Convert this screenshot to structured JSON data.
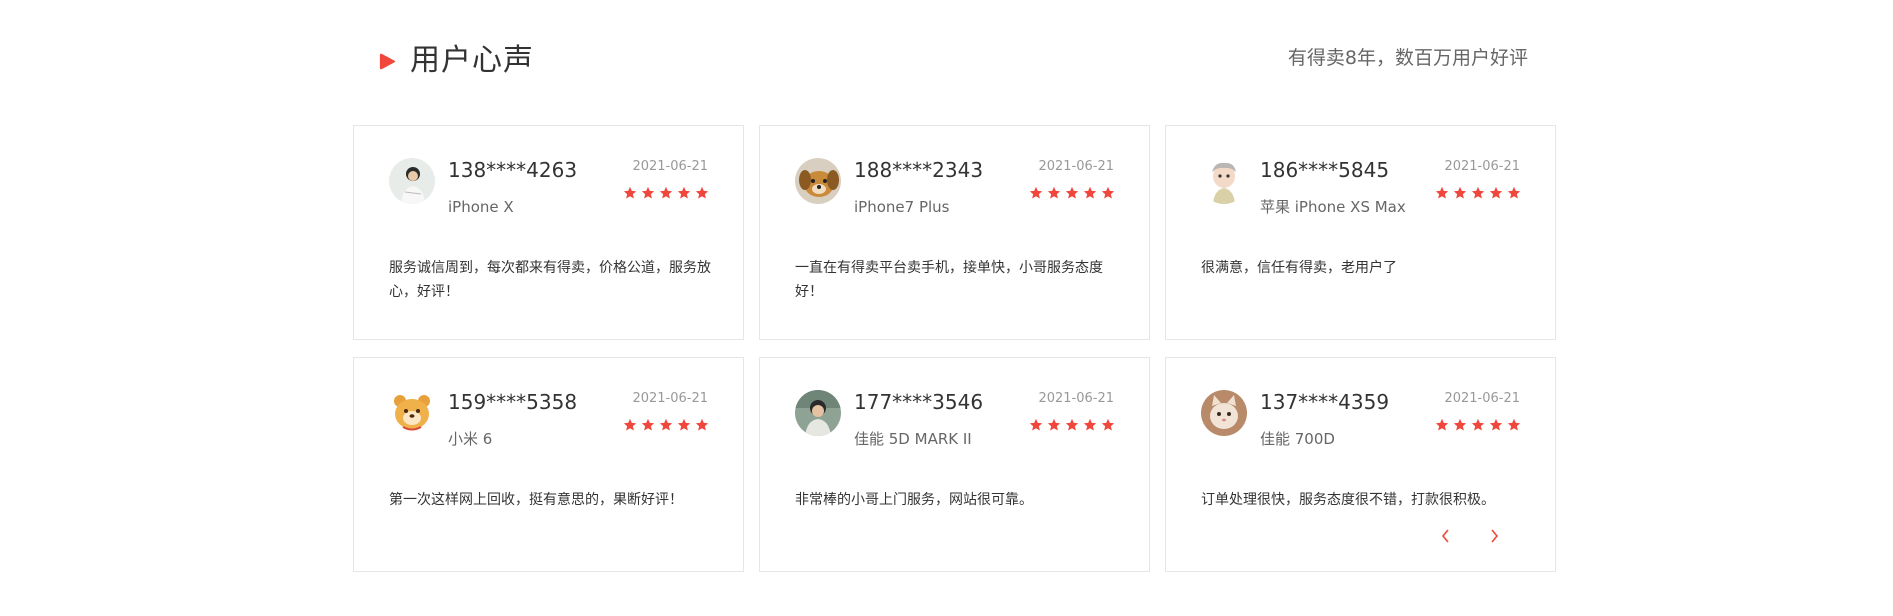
{
  "section": {
    "title": "用户心声",
    "subtitle": "有得卖8年，数百万用户好评"
  },
  "colors": {
    "accent": "#f0463c",
    "star": "#f0463c",
    "border": "#e6e6e6"
  },
  "reviews": [
    {
      "user": "138****4263",
      "device": "iPhone X",
      "date": "2021-06-21",
      "rating": 5,
      "text": "服务诚信周到，每次都来有得卖，价格公道，服务放心，好评！",
      "avatar": "person-avatar"
    },
    {
      "user": "188****2343",
      "device": "iPhone7 Plus",
      "date": "2021-06-21",
      "rating": 5,
      "text": "一直在有得卖平台卖手机，接单快，小哥服务态度好！",
      "avatar": "dog-avatar"
    },
    {
      "user": "186****5845",
      "device": "苹果 iPhone XS Max",
      "date": "2021-06-21",
      "rating": 5,
      "text": "很满意，信任有得卖，老用户了",
      "avatar": "cartoon-avatar"
    },
    {
      "user": "159****5358",
      "device": "小米 6",
      "date": "2021-06-21",
      "rating": 5,
      "text": "第一次这样网上回收，挺有意思的，果断好评！",
      "avatar": "bear-avatar"
    },
    {
      "user": "177****3546",
      "device": "佳能 5D MARK II",
      "date": "2021-06-21",
      "rating": 5,
      "text": "非常棒的小哥上门服务，网站很可靠。",
      "avatar": "person-avatar"
    },
    {
      "user": "137****4359",
      "device": "佳能 700D",
      "date": "2021-06-21",
      "rating": 5,
      "text": "订单处理很快，服务态度很不错，打款很积极。",
      "avatar": "cat-avatar"
    }
  ],
  "navigation": {
    "prev_icon": "chevron-left-icon",
    "next_icon": "chevron-right-icon"
  }
}
